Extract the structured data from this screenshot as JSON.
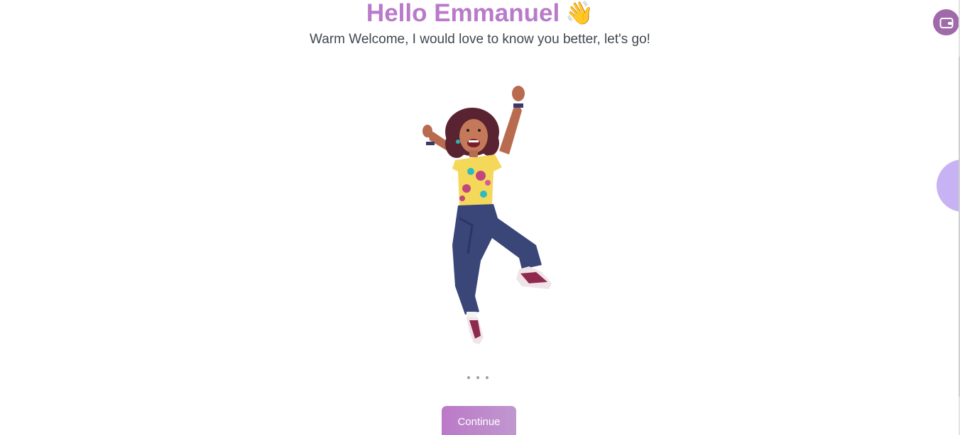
{
  "header": {
    "greeting": "Hello Emmanuel",
    "wave_emoji": "👋",
    "subtitle": "Warm Welcome, I would love to know you better, let's go!"
  },
  "illustration": {
    "icon": "jumping-woman-illustration"
  },
  "pagination": {
    "icon": "loading-dots-icon"
  },
  "actions": {
    "continue_label": "Continue"
  },
  "side": {
    "wallet_icon": "wallet-icon",
    "side_tab_icon": "side-panel-toggle"
  },
  "colors": {
    "accent": "#b97ac9",
    "button_start": "#bb79c8",
    "button_end": "#c097cf",
    "wallet_bg": "#a06aaa",
    "side_tab": "#c7b3f4",
    "text": "#3f4750"
  }
}
